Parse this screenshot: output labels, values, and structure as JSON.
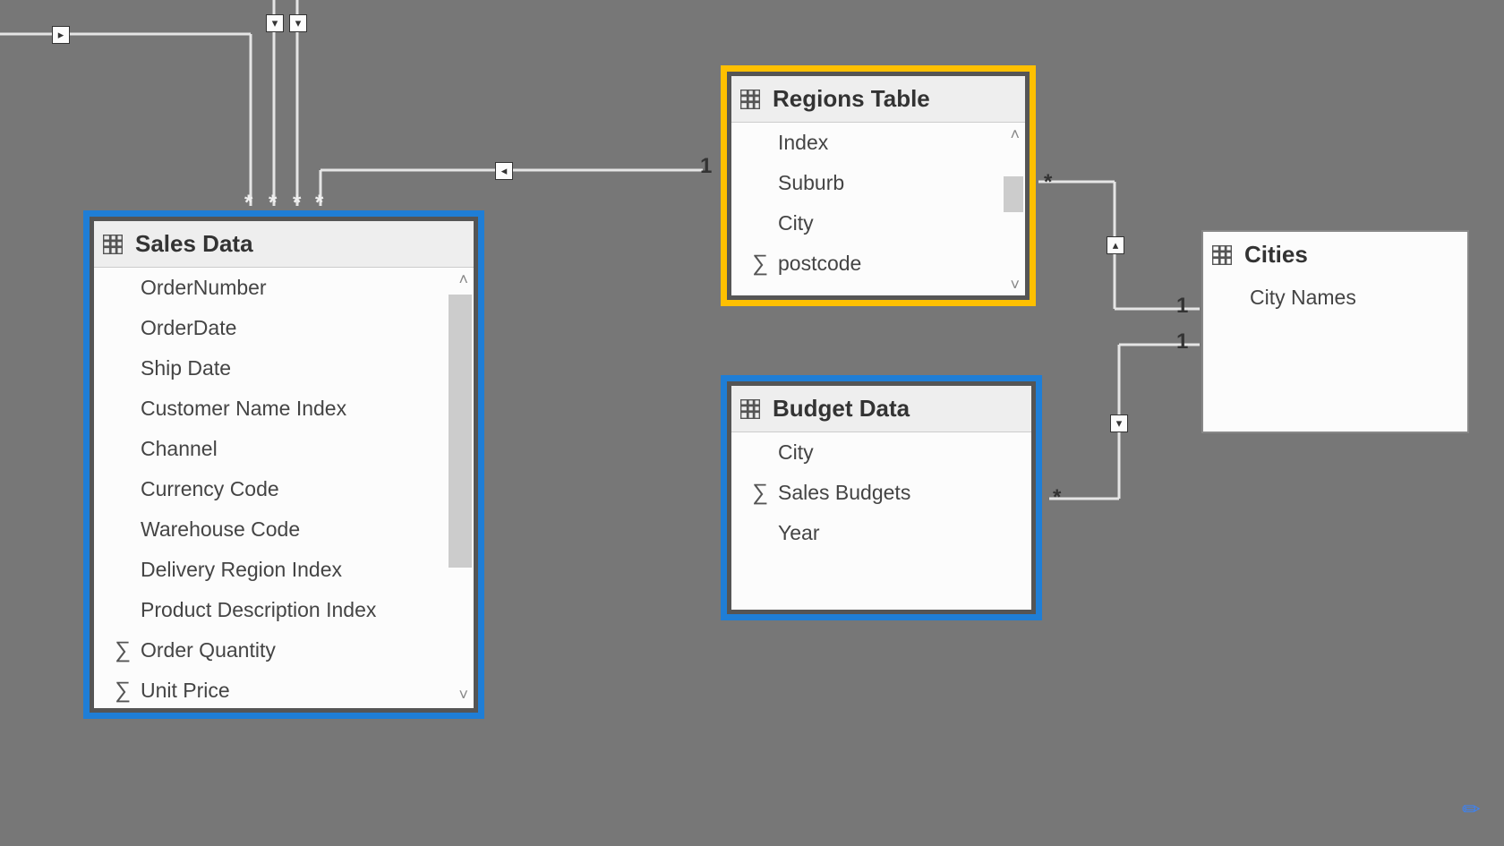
{
  "tables": {
    "sales": {
      "title": "Sales Data",
      "fields": [
        {
          "sigma": false,
          "label": "OrderNumber"
        },
        {
          "sigma": false,
          "label": "OrderDate"
        },
        {
          "sigma": false,
          "label": "Ship Date"
        },
        {
          "sigma": false,
          "label": "Customer Name Index"
        },
        {
          "sigma": false,
          "label": "Channel"
        },
        {
          "sigma": false,
          "label": "Currency Code"
        },
        {
          "sigma": false,
          "label": "Warehouse Code"
        },
        {
          "sigma": false,
          "label": "Delivery Region Index"
        },
        {
          "sigma": false,
          "label": "Product Description Index"
        },
        {
          "sigma": true,
          "label": "Order Quantity"
        },
        {
          "sigma": true,
          "label": "Unit Price"
        }
      ]
    },
    "regions": {
      "title": "Regions Table",
      "fields": [
        {
          "sigma": false,
          "label": "Index"
        },
        {
          "sigma": false,
          "label": "Suburb"
        },
        {
          "sigma": false,
          "label": "City"
        },
        {
          "sigma": true,
          "label": "postcode"
        }
      ]
    },
    "budget": {
      "title": "Budget Data",
      "fields": [
        {
          "sigma": false,
          "label": "City"
        },
        {
          "sigma": true,
          "label": "Sales Budgets"
        },
        {
          "sigma": false,
          "label": "Year"
        }
      ]
    },
    "cities": {
      "title": "Cities",
      "fields": [
        {
          "sigma": false,
          "label": "City Names"
        }
      ]
    }
  },
  "relationships": {
    "sales_regions": {
      "many": "*",
      "one": "1"
    },
    "regions_cities": {
      "many": "*",
      "one": "1"
    },
    "budget_cities": {
      "many": "*",
      "one": "1"
    }
  },
  "glyphs": {
    "sigma": "∑",
    "up": "˄",
    "down": "˅",
    "star": "*"
  }
}
